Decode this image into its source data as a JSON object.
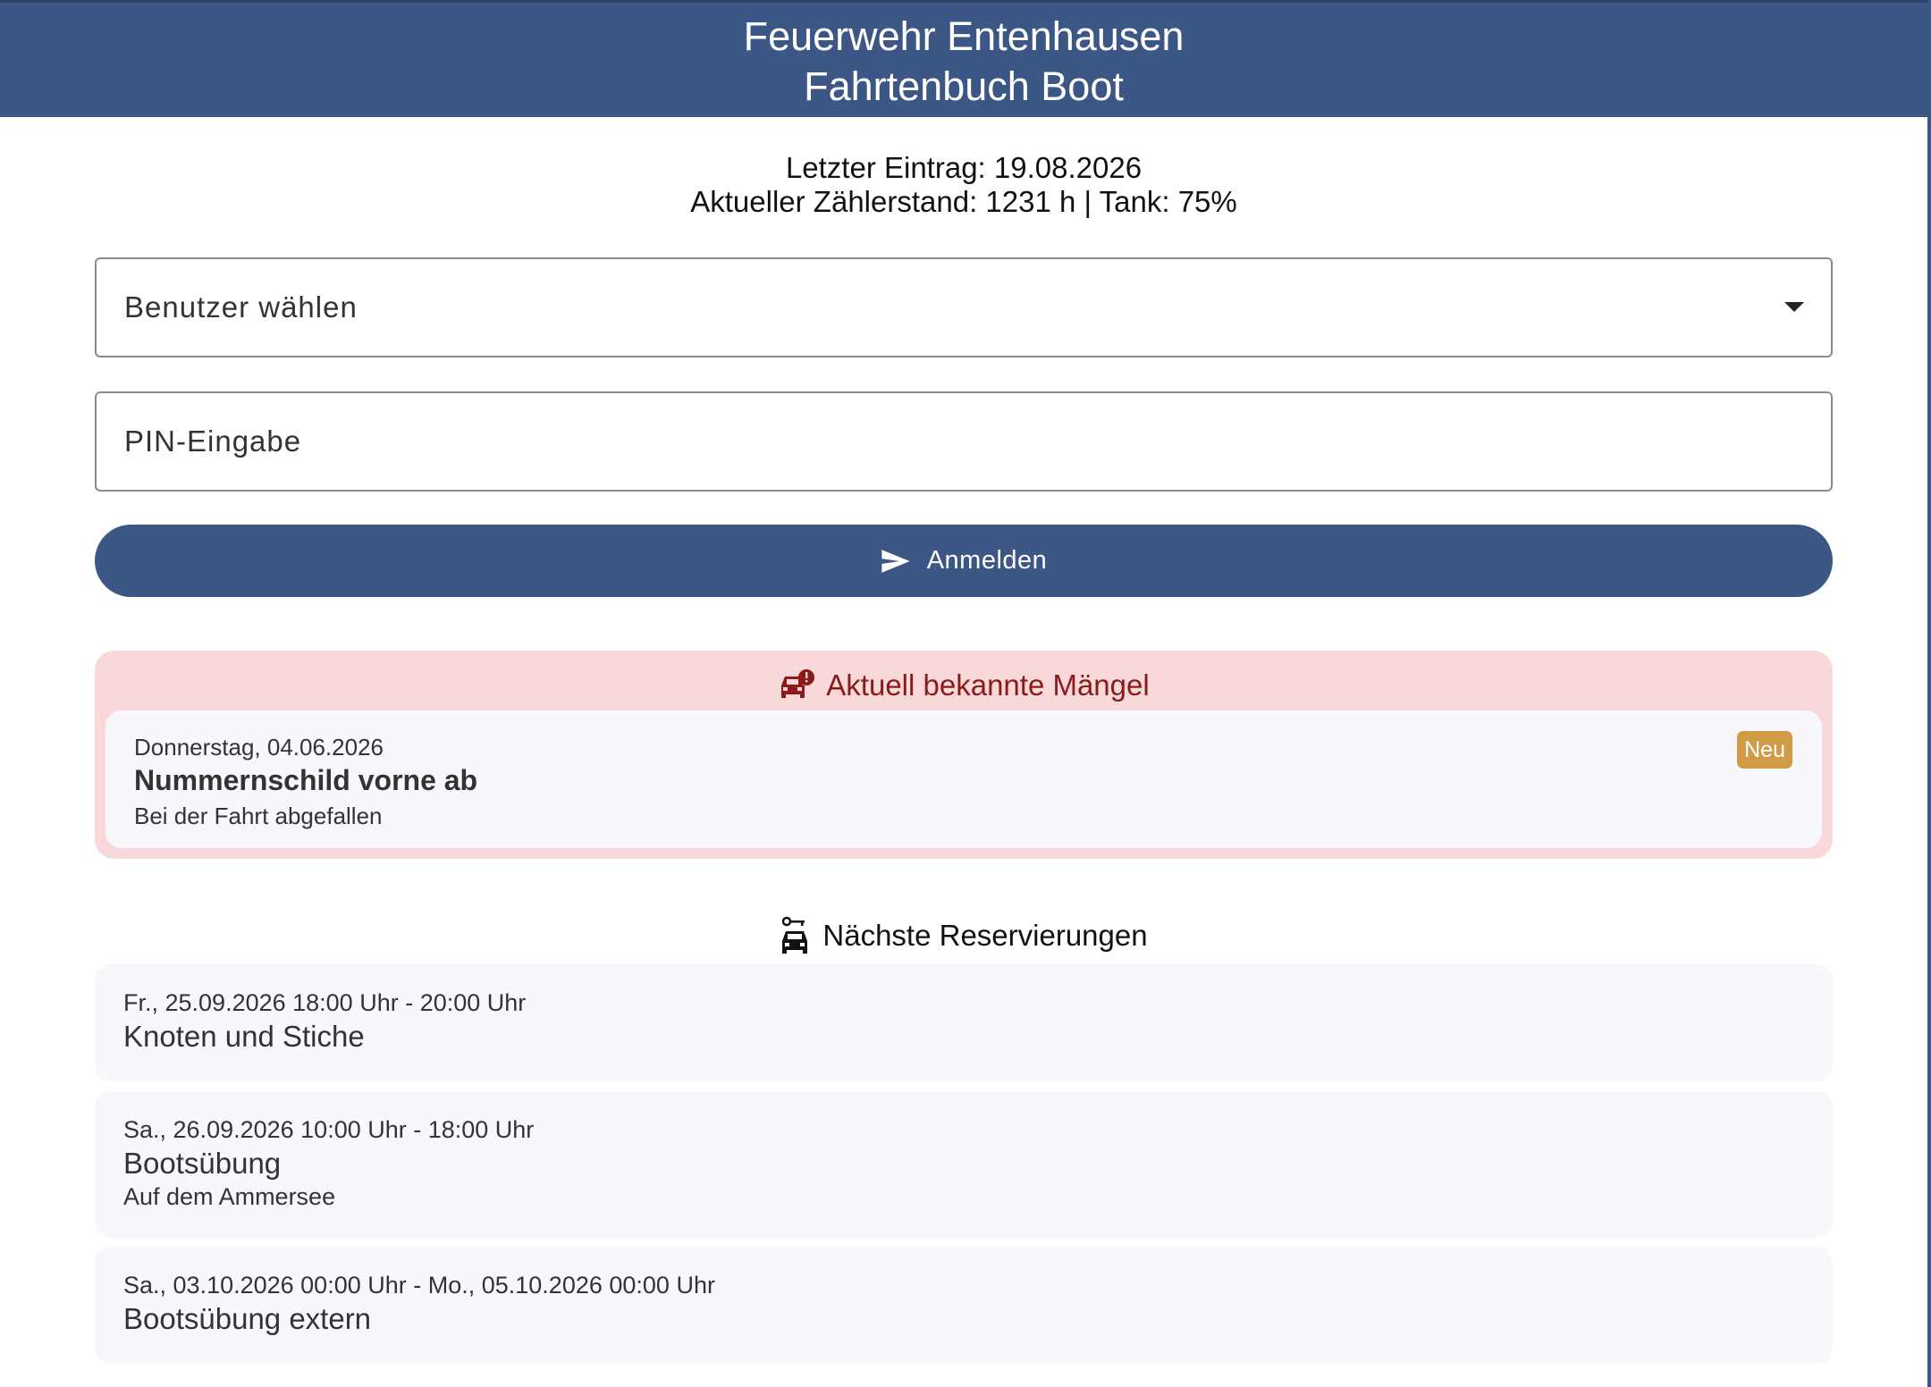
{
  "header": {
    "line1": "Feuerwehr Entenhausen",
    "line2": "Fahrtenbuch Boot"
  },
  "info": {
    "last_entry": "Letzter Eintrag: 19.08.2026",
    "meter": "Aktueller Zählerstand: 1231 h | Tank: 75%"
  },
  "form": {
    "user_select_label": "Benutzer wählen",
    "pin_placeholder": "PIN-Eingabe",
    "pin_value": "",
    "login_label": "Anmelden"
  },
  "defects": {
    "title": "Aktuell bekannte Mängel",
    "items": [
      {
        "date": "Donnerstag, 04.06.2026",
        "name": "Nummernschild vorne ab",
        "desc": "Bei der Fahrt abgefallen",
        "badge": "Neu"
      }
    ]
  },
  "reservations": {
    "title": "Nächste Reservierungen",
    "items": [
      {
        "when": "Fr., 25.09.2026 18:00 Uhr - 20:00 Uhr",
        "what": "Knoten und Stiche",
        "note": ""
      },
      {
        "when": "Sa., 26.09.2026 10:00 Uhr - 18:00 Uhr",
        "what": "Bootsübung",
        "note": "Auf dem Ammersee"
      },
      {
        "when": "Sa., 03.10.2026 00:00 Uhr - Mo., 05.10.2026 00:00 Uhr",
        "what": "Bootsübung extern",
        "note": ""
      }
    ]
  },
  "colors": {
    "primary": "#3c5685",
    "defect_bg": "#f8d8d8",
    "defect_text": "#8b1a1a",
    "badge": "#d19a44",
    "card_bg": "#f7f7fc"
  },
  "icons": {
    "send": "send-icon",
    "defect": "car-warning-icon",
    "reservation": "car-key-icon"
  }
}
